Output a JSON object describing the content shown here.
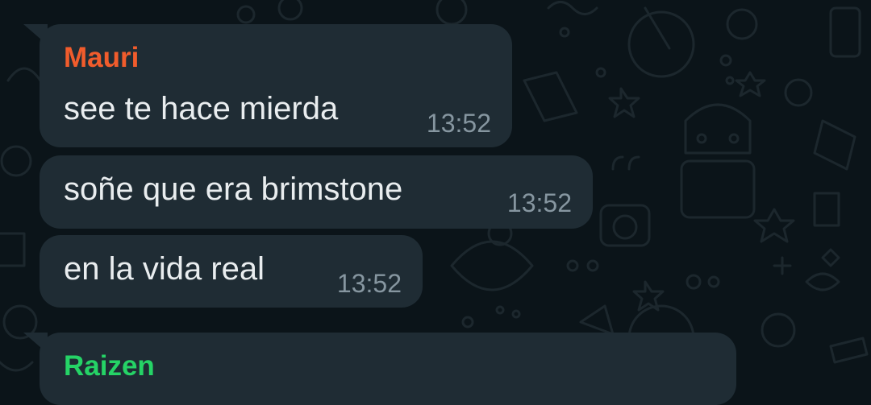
{
  "chat": {
    "colors": {
      "background": "#0b1419",
      "bubble": "#1f2c34",
      "message_text": "#e9edef",
      "timestamp": "#8696a0",
      "sender_mauri": "#f15c2c",
      "sender_raizen": "#25d366",
      "doodle": "#1c272d"
    },
    "messages": [
      {
        "sender": "Mauri",
        "text": "see te hace mierda",
        "time": "13:52"
      },
      {
        "text": "soñe que era brimstone",
        "time": "13:52"
      },
      {
        "text": "en la vida real",
        "time": "13:52"
      },
      {
        "sender": "Raizen"
      }
    ]
  }
}
